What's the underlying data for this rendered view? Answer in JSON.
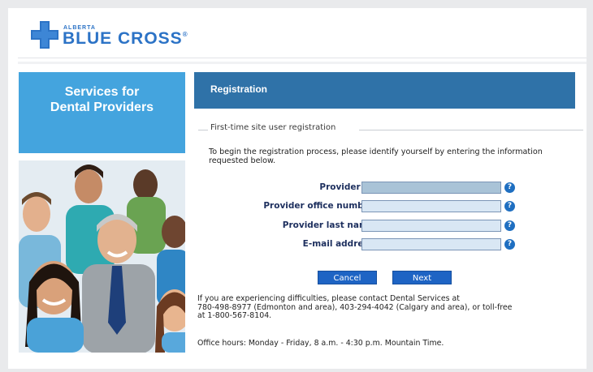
{
  "brand": {
    "small_text": "ALBERTA",
    "name": "BLUE CROSS",
    "mark": "®",
    "color": "#2c73c6"
  },
  "sidebar": {
    "title_line1": "Services for",
    "title_line2": "Dental Providers",
    "panel_color": "#44a4de"
  },
  "registration": {
    "header": "Registration",
    "legend": "First-time site user registration",
    "intro": "To begin the registration process, please identify yourself by entering the information requested below.",
    "fields": [
      {
        "label": "Provider ID",
        "value": "",
        "help_icon": "question-icon"
      },
      {
        "label": "Provider office number",
        "value": "",
        "help_icon": "question-icon"
      },
      {
        "label": "Provider last name",
        "value": "",
        "help_icon": "question-icon"
      },
      {
        "label": "E-mail address",
        "value": "",
        "help_icon": "question-icon"
      }
    ],
    "help_glyph": "?",
    "buttons": {
      "cancel": "Cancel",
      "next": "Next"
    },
    "contact_line1": "If you are experiencing difficulties, please contact Dental Services at",
    "contact_line2": "780-498-8977 (Edmonton and area), 403-294-4042 (Calgary and area), or toll-free",
    "contact_line3": "at 1-800-567-8104.",
    "hours": "Office hours: Monday - Friday, 8 a.m. - 4:30 p.m. Mountain Time.",
    "header_color": "#2f72a8",
    "button_color": "#1e64c4"
  }
}
